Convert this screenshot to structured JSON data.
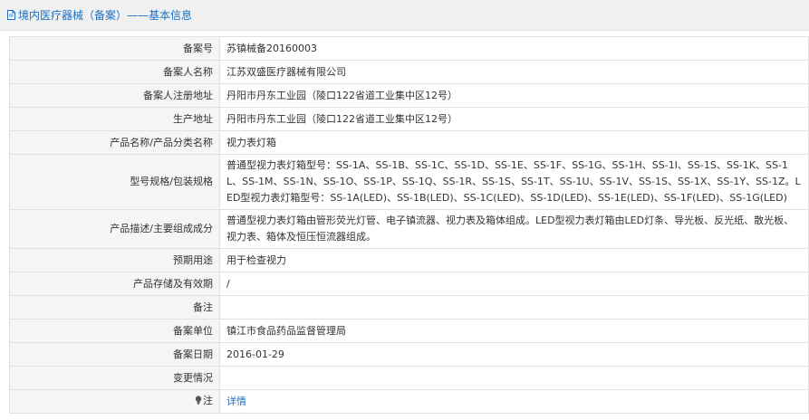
{
  "header": {
    "title": "境内医疗器械（备案）——基本信息",
    "icon": "document-icon",
    "accent_color": "#1a6fc4"
  },
  "rows": [
    {
      "label": "备案号",
      "value": "苏镇械备20160003"
    },
    {
      "label": "备案人名称",
      "value": "江苏双盛医疗器械有限公司"
    },
    {
      "label": "备案人注册地址",
      "value": "丹阳市丹东工业园（陵口122省道工业集中区12号）"
    },
    {
      "label": "生产地址",
      "value": "丹阳市丹东工业园（陵口122省道工业集中区12号）"
    },
    {
      "label": "产品名称/产品分类名称",
      "value": "视力表灯箱"
    },
    {
      "label": "型号规格/包装规格",
      "value": "普通型视力表灯箱型号：SS-1A、SS-1B、SS-1C、SS-1D、SS-1E、SS-1F、SS-1G、SS-1H、SS-1I、SS-1S、SS-1K、SS-1L、SS-1M、SS-1N、SS-1O、SS-1P、SS-1Q、SS-1R、SS-1S、SS-1T、SS-1U、SS-1V、SS-1S、SS-1X、SS-1Y、SS-1Z。LED型视力表灯箱型号：SS-1A(LED)、SS-1B(LED)、SS-1C(LED)、SS-1D(LED)、SS-1E(LED)、SS-1F(LED)、SS-1G(LED)"
    },
    {
      "label": "产品描述/主要组成成分",
      "value": "普通型视力表灯箱由管形荧光灯管、电子镇流器、视力表及箱体组成。LED型视力表灯箱由LED灯条、导光板、反光纸、散光板、视力表、箱体及恒压恒流器组成。"
    },
    {
      "label": "预期用途",
      "value": "用于检查视力"
    },
    {
      "label": "产品存储及有效期",
      "value": "/"
    },
    {
      "label": "备注",
      "value": ""
    },
    {
      "label": "备案单位",
      "value": "镇江市食品药品监督管理局"
    },
    {
      "label": "备案日期",
      "value": "2016-01-29"
    },
    {
      "label": "变更情况",
      "value": ""
    }
  ],
  "note_row": {
    "label": "注",
    "icon": "lightbulb-icon",
    "link_text": "详情"
  }
}
